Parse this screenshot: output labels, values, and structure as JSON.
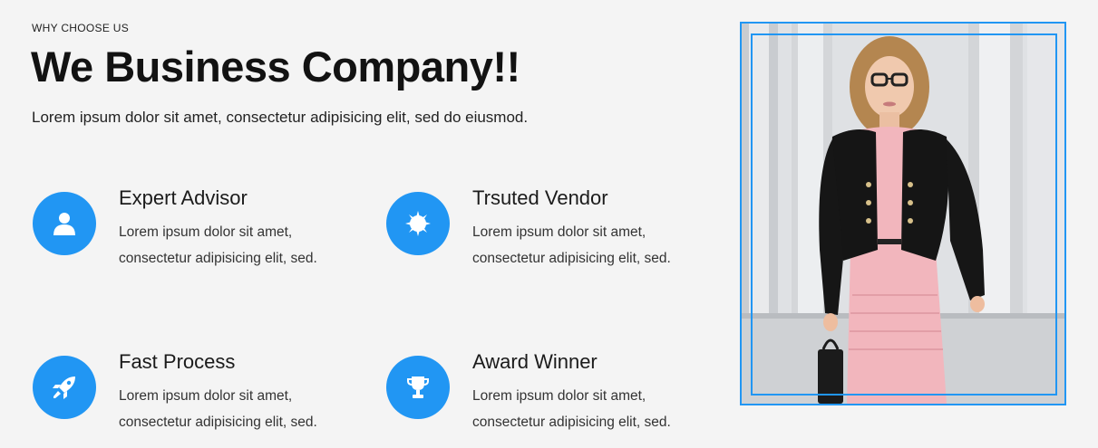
{
  "section": {
    "eyebrow": "WHY CHOOSE US",
    "headline": "We Business Company!!",
    "lead": "Lorem ipsum dolor sit amet, consectetur adipisicing elit, sed do eiusmod."
  },
  "features": [
    {
      "icon": "user-icon",
      "title": "Expert Advisor",
      "desc": "Lorem ipsum dolor sit amet, consectetur adipisicing elit, sed."
    },
    {
      "icon": "badge-icon",
      "title": "Trsuted Vendor",
      "desc": "Lorem ipsum dolor sit amet, consectetur adipisicing elit, sed."
    },
    {
      "icon": "rocket-icon",
      "title": "Fast Process",
      "desc": "Lorem ipsum dolor sit amet, consectetur adipisicing elit, sed."
    },
    {
      "icon": "trophy-icon",
      "title": "Award Winner",
      "desc": "Lorem ipsum dolor sit amet, consectetur adipisicing elit, sed."
    }
  ],
  "colors": {
    "accent": "#2196f3",
    "background": "#f4f4f4",
    "heading": "#121212"
  },
  "image": {
    "subject": "businesswoman-photo"
  }
}
